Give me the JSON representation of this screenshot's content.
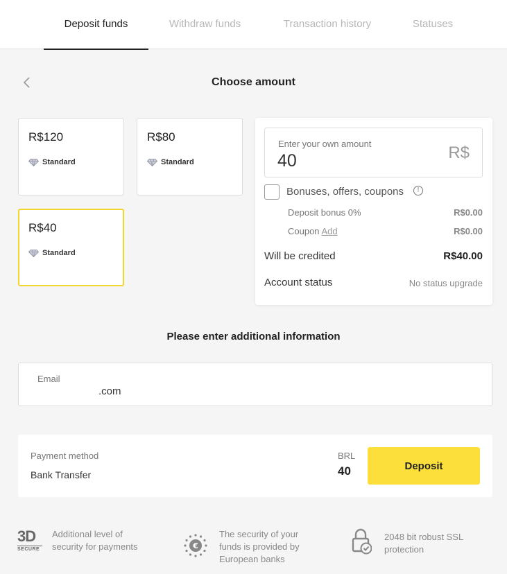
{
  "tabs": [
    {
      "label": "Deposit funds",
      "active": true
    },
    {
      "label": "Withdraw funds",
      "active": false
    },
    {
      "label": "Transaction history",
      "active": false
    },
    {
      "label": "Statuses",
      "active": false
    }
  ],
  "heading": "Choose amount",
  "cards": [
    {
      "amount": "R$120",
      "tier": "Standard",
      "selected": false
    },
    {
      "amount": "R$80",
      "tier": "Standard",
      "selected": false
    },
    {
      "amount": "R$40",
      "tier": "Standard",
      "selected": true
    }
  ],
  "custom_amount": {
    "label": "Enter your own amount",
    "value": "40",
    "currency": "R$"
  },
  "bonuses": {
    "label": "Bonuses, offers, coupons",
    "deposit_bonus_label": "Deposit bonus 0%",
    "deposit_bonus_value": "R$0.00",
    "coupon_label": "Coupon",
    "coupon_link": "Add",
    "coupon_value": "R$0.00"
  },
  "credited": {
    "label": "Will be credited",
    "value": "R$40.00"
  },
  "account_status": {
    "label": "Account status",
    "value": "No status upgrade"
  },
  "additional_heading": "Please enter additional information",
  "email": {
    "label": "Email",
    "value": ".com"
  },
  "payment": {
    "label": "Payment method",
    "method": "Bank Transfer",
    "currency": "BRL",
    "amount": "40",
    "button": "Deposit"
  },
  "features": {
    "secure_logo": "3D",
    "secure_logo_sub": "SECURE",
    "f1_line1": "Additional level of",
    "f1_line2": "security for payments",
    "f2_line1": "The security of your",
    "f2_line2": "funds is provided by",
    "f2_line3": "European banks",
    "f3_line1": "2048 bit robust SSL",
    "f3_line2": "protection"
  },
  "colors": {
    "accent": "#fddf3c",
    "selected_border": "#f2d630"
  }
}
